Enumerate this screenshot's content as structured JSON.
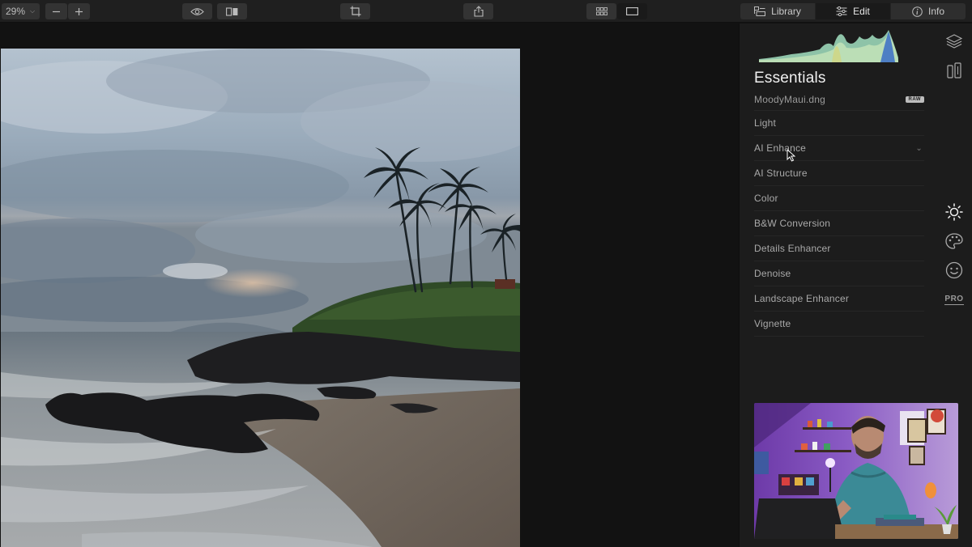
{
  "toolbar": {
    "zoom_value": "29%",
    "zoom_out_icon": "minus-icon",
    "zoom_in_icon": "plus-icon",
    "preview_icon": "eye-icon",
    "compare_icon": "compare-icon",
    "crop_icon": "crop-icon",
    "share_icon": "share-icon",
    "grid_view_icon": "grid-icon",
    "single_view_icon": "single-view-icon",
    "tabs": [
      {
        "label": "Library",
        "icon": "library-icon",
        "active": false
      },
      {
        "label": "Edit",
        "icon": "sliders-icon",
        "active": true
      },
      {
        "label": "Info",
        "icon": "info-icon",
        "active": false
      }
    ]
  },
  "panel": {
    "title": "Essentials",
    "filename": "MoodyMaui.dng",
    "file_badge": "RAW",
    "tools": [
      {
        "label": "Light"
      },
      {
        "label": "AI Enhance",
        "expandable": true
      },
      {
        "label": "AI Structure"
      },
      {
        "label": "Color"
      },
      {
        "label": "B&W Conversion"
      },
      {
        "label": "Details Enhancer"
      },
      {
        "label": "Denoise"
      },
      {
        "label": "Landscape Enhancer"
      },
      {
        "label": "Vignette"
      }
    ],
    "side_icons_top": [
      "layers-icon",
      "presets-icon"
    ],
    "side_icons_mid": [
      "sun-icon",
      "palette-icon",
      "face-icon"
    ],
    "pro_label": "PRO"
  },
  "colors": {
    "background": "#121212",
    "panel": "#1c1c1c",
    "toolbar": "#1f1f1f",
    "active_tab": "#1a1a1a"
  }
}
